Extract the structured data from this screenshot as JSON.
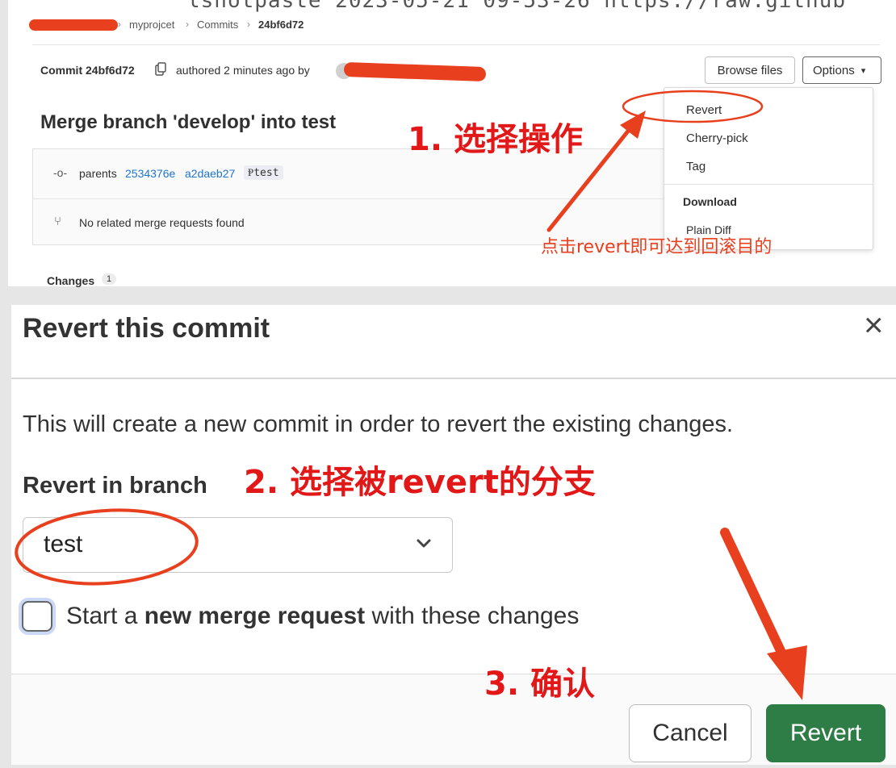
{
  "top": {
    "url_fragment": "lshotpaste 2023-05-21 09-53-26 https://raw.github",
    "breadcrumb": [
      "myprojcet",
      "Commits",
      "24bf6d72"
    ],
    "breadcrumb_sep": "›",
    "commit_label": "Commit 24bf6d72",
    "authored": "authored 2 minutes ago by",
    "browse_files": "Browse files",
    "options": "Options",
    "title": "Merge branch 'develop' into test",
    "parents_label": "parents",
    "parent_shas": [
      "2534376e",
      "a2daeb27"
    ],
    "branch_tag": "test",
    "no_mr": "No related merge requests found",
    "changes_label": "Changes",
    "changes_count": "1",
    "dropdown": {
      "items": [
        "Revert",
        "Cherry-pick",
        "Tag"
      ],
      "section": "Download",
      "plain_diff": "Plain Diff"
    }
  },
  "annotations": {
    "step1": "1. 选择操作",
    "step1_note": "点击revert即可达到回滚目的",
    "step2_prefix": "2. 选择被",
    "step2_bold": "revert",
    "step2_suffix": "的分支",
    "step3": "3. 确认"
  },
  "modal": {
    "title": "Revert this commit",
    "close": "×",
    "description": "This will create a new commit in order to revert the existing changes.",
    "branch_label": "Revert in branch",
    "branch_value": "test",
    "checkbox_text_pre": "Start a",
    "checkbox_text_bold": "new merge request",
    "checkbox_text_post": "with these changes",
    "cancel": "Cancel",
    "revert": "Revert"
  },
  "colors": {
    "accent_red": "#e21818",
    "arrow_red": "#e8401f",
    "revert_green": "#2e7d47",
    "link_blue": "#1f75cb"
  }
}
